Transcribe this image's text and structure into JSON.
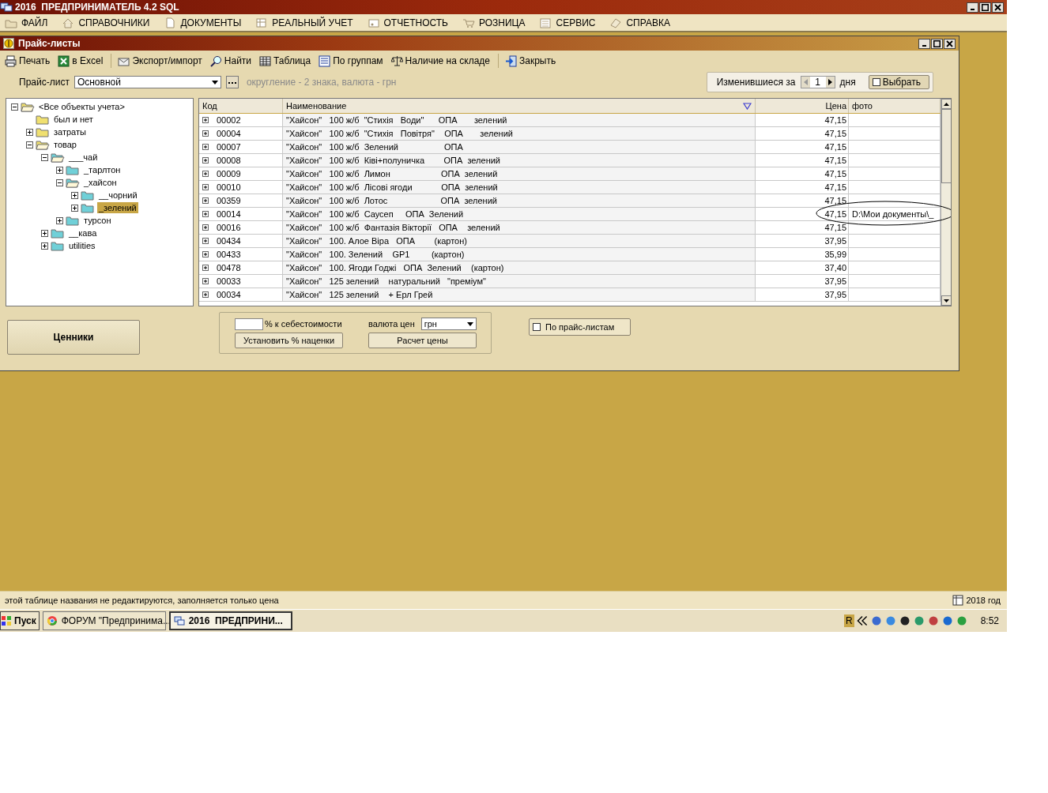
{
  "app_title": "2016  ПРЕДПРИНИМАТЕЛЬ 4.2 SQL",
  "menu": [
    "ФАЙЛ",
    "СПРАВОЧНИКИ",
    "ДОКУМЕНТЫ",
    "РЕАЛЬНЫЙ УЧЕТ",
    "ОТЧЕТНОСТЬ",
    "РОЗНИЦА",
    "СЕРВИС",
    "СПРАВКА"
  ],
  "window": {
    "title": "Прайс-листы"
  },
  "toolbar": [
    "Печать",
    "в Excel",
    "Экспорт/импорт",
    "Найти",
    "Таблица",
    "По группам",
    "Наличие на складе",
    "Закрыть"
  ],
  "price_list": {
    "label": "Прайс-лист",
    "value": "Основной",
    "note": "округление - 2 знака, валюта - грн"
  },
  "changed_filter": {
    "label": "Изменившиеся за",
    "value": "1",
    "unit": "дня",
    "select_label": "Выбрать",
    "select_checked": false
  },
  "tree": [
    {
      "label": "<Все объекты учета>",
      "expandable": true,
      "expanded": true,
      "selected": false,
      "children": [
        {
          "label": "был и нет",
          "expandable": false,
          "expanded": false,
          "selected": false
        },
        {
          "label": "затраты",
          "expandable": true,
          "expanded": false,
          "selected": false
        },
        {
          "label": "товар",
          "expandable": true,
          "expanded": true,
          "selected": false,
          "children": [
            {
              "label": "___чай",
              "expandable": true,
              "expanded": true,
              "selected": false,
              "children": [
                {
                  "label": "_тарлтон",
                  "expandable": true,
                  "expanded": false,
                  "selected": false
                },
                {
                  "label": "_хайсон",
                  "expandable": true,
                  "expanded": true,
                  "selected": false,
                  "children": [
                    {
                      "label": "__чорний",
                      "expandable": true,
                      "expanded": false,
                      "selected": false
                    },
                    {
                      "label": "_зелений",
                      "expandable": true,
                      "expanded": false,
                      "selected": true
                    }
                  ]
                },
                {
                  "label": "турсон",
                  "expandable": true,
                  "expanded": false,
                  "selected": false
                }
              ]
            },
            {
              "label": "__кава",
              "expandable": true,
              "expanded": false,
              "selected": false
            },
            {
              "label": "utilities",
              "expandable": true,
              "expanded": false,
              "selected": false
            }
          ]
        }
      ]
    }
  ],
  "table": {
    "columns": [
      {
        "label": "Код",
        "sorted": false
      },
      {
        "label": "Наименование",
        "sorted": true
      },
      {
        "label": "Цена",
        "sorted": false
      },
      {
        "label": "фото",
        "sorted": false
      }
    ],
    "rows": [
      {
        "code": "00002",
        "name": "\"Хайсон\"   100 ж/б  \"Стихія   Води\"      ОПА       зелений",
        "price": "47,15",
        "circled": false
      },
      {
        "code": "00004",
        "name": "\"Хайсон\"   100 ж/б  \"Стихія   Повітря\"    ОПА       зелений",
        "price": "47,15",
        "circled": false
      },
      {
        "code": "00007",
        "name": "\"Хайсон\"   100 ж/б  Зелений                   ОПА",
        "price": "47,15",
        "circled": false
      },
      {
        "code": "00008",
        "name": "\"Хайсон\"   100 ж/б  Ківі+полуничка        ОПА  зелений",
        "price": "47,15",
        "circled": false
      },
      {
        "code": "00009",
        "name": "\"Хайсон\"   100 ж/б  Лимон                     ОПА  зелений",
        "price": "47,15",
        "circled": false
      },
      {
        "code": "00010",
        "name": "\"Хайсон\"   100 ж/б  Лісові ягоди            ОПА  зелений",
        "price": "47,15",
        "circled": false
      },
      {
        "code": "00359",
        "name": "\"Хайсон\"   100 ж/б  Лотос                      ОПА  зелений",
        "price": "47,15",
        "circled": false
      },
      {
        "code": "00014",
        "name": "\"Хайсон\"   100 ж/б  Саусеп     ОПА  Зелений",
        "price": "47,15",
        "photo": "D:\\Мои документы\\_",
        "circled": true
      },
      {
        "code": "00016",
        "name": "\"Хайсон\"   100 ж/б  Фантазія Вікторії   ОПА    зелений",
        "price": "47,15",
        "circled": false
      },
      {
        "code": "00434",
        "name": "\"Хайсон\"   100. Алое Віра   ОПА        (картон)",
        "price": "37,95",
        "circled": false
      },
      {
        "code": "00433",
        "name": "\"Хайсон\"   100. Зелений    GP1         (картон)",
        "price": "35,99",
        "circled": false
      },
      {
        "code": "00478",
        "name": "\"Хайсон\"   100. Ягоди Годжі   ОПА  Зелений    (картон)",
        "price": "37,40",
        "circled": false
      },
      {
        "code": "00033",
        "name": "\"Хайсон\"   125 зелений    натуральний   \"преміум\"",
        "price": "37,95",
        "circled": false
      },
      {
        "code": "00034",
        "name": "\"Хайсон\"   125 зелений    + Ерл Грей",
        "price": "37,95",
        "circled": false
      }
    ]
  },
  "tags_button": "Ценники",
  "markup": {
    "label": "% к себестоимости",
    "button": "Установить % наценки"
  },
  "currency": {
    "label": "валюта цен",
    "value": "грн",
    "button": "Расчет цены"
  },
  "by_price_lists": {
    "label": "По прайс-листам",
    "checked": false
  },
  "status_bar": {
    "message": "этой таблице названия не редактируются, заполняется только цена",
    "year": "2018 год"
  },
  "taskbar": {
    "start": "Пуск",
    "tasks": [
      {
        "label": "ФОРУМ \"Предпринима...",
        "selected": false
      },
      {
        "label": "2016  ПРЕДПРИНИ...",
        "selected": true
      }
    ],
    "language": "R",
    "clock": "8:52"
  }
}
